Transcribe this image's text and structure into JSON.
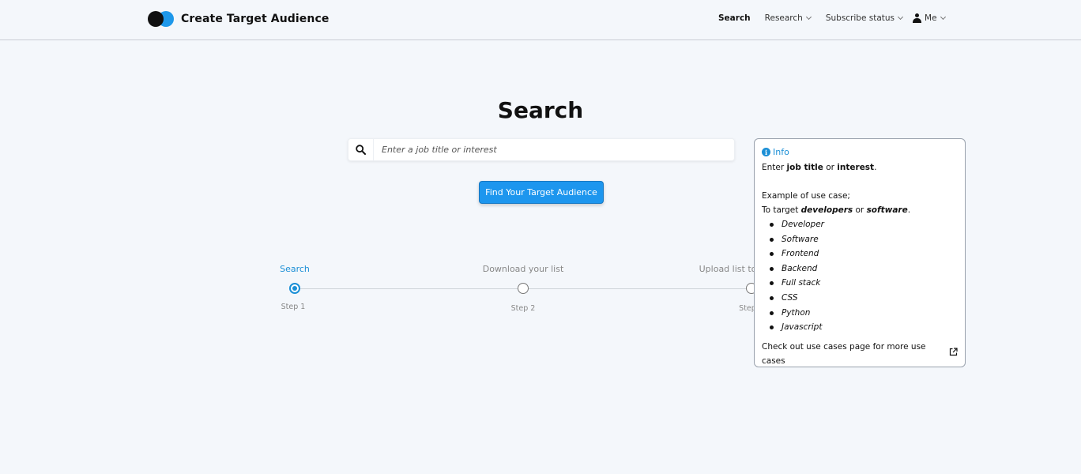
{
  "brand": {
    "name": "Create Target Audience"
  },
  "nav": {
    "search": "Search",
    "research": "Research",
    "subscribe": "Subscribe status",
    "me": "Me"
  },
  "page": {
    "title": "Search"
  },
  "search": {
    "placeholder": "Enter a job title or interest"
  },
  "cta": {
    "label": "Find Your Target Audience"
  },
  "steps": [
    {
      "title": "Search",
      "sub": "Step 1",
      "active": true
    },
    {
      "title": "Download your list",
      "sub": "Step 2",
      "active": false
    },
    {
      "title": "Upload list to",
      "sub": "Step",
      "active": false
    }
  ],
  "info": {
    "heading": "Info",
    "enter_prefix": "Enter ",
    "job_title": "job title",
    "or": " or ",
    "interest": "interest",
    "period": ".",
    "example": "Example of use case;",
    "target_prefix": "To target ",
    "developers": "developers",
    "software": "software",
    "items": [
      "Developer",
      "Software",
      "Frontend",
      "Backend",
      "Full stack",
      "CSS",
      "Python",
      "Javascript"
    ],
    "footer": "Check out use cases page for more use cases"
  },
  "colors": {
    "accent": "#1d96ee",
    "active_step": "#1b8fd6",
    "background": "#f4f7fb"
  }
}
